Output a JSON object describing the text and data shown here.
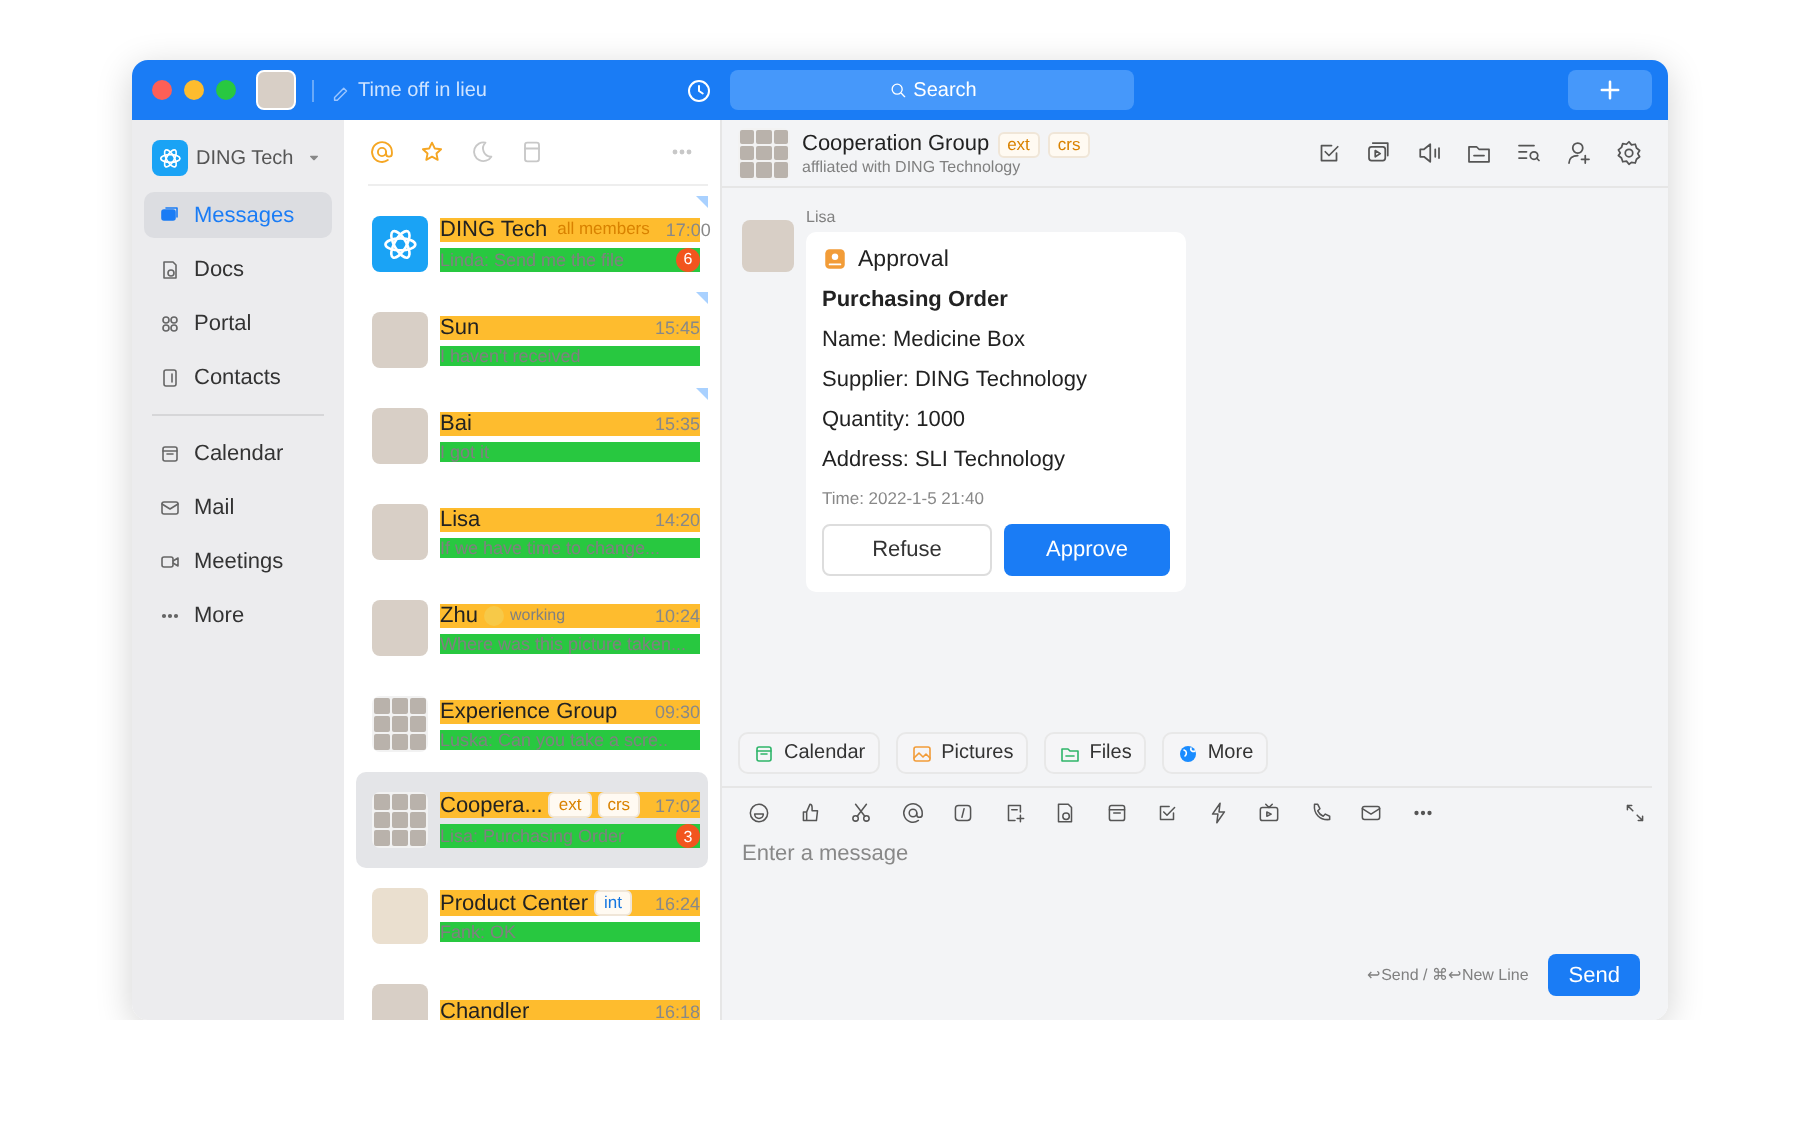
{
  "title_bar": {
    "status": "Time off in lieu",
    "search": {
      "placeholder": "Search"
    }
  },
  "sidebar": {
    "org": "DING Tech",
    "sections": [
      {
        "items": [
          {
            "label": "Messages",
            "selected": true
          },
          {
            "label": "Docs",
            "selected": false
          },
          {
            "label": "Portal",
            "selected": false
          },
          {
            "label": "Contacts",
            "selected": false
          }
        ]
      },
      {
        "items": [
          {
            "label": "Calendar",
            "selected": false
          },
          {
            "label": "Mail",
            "selected": false
          },
          {
            "label": "Meetings",
            "selected": false
          },
          {
            "label": "More",
            "selected": false
          }
        ]
      }
    ]
  },
  "list_tabs": [
    {
      "on": true
    },
    {
      "on": true
    },
    {
      "on": false
    },
    {
      "on": false
    }
  ],
  "conversations": [
    {
      "name": "DING Tech",
      "kind": "logo",
      "tags": [
        {
          "text": "all members",
          "kind": "plain",
          "color": "#d98200"
        }
      ],
      "time": "17:00",
      "preview": "Linda: Send me the file",
      "unread": "6",
      "pinned": true,
      "selected": false
    },
    {
      "name": "Sun",
      "kind": "person",
      "time": "15:45",
      "preview": "I haven't received",
      "pinned": true,
      "selected": false
    },
    {
      "name": "Bai",
      "kind": "person",
      "time": "15:35",
      "preview": "I got it",
      "pinned": true,
      "selected": false
    },
    {
      "name": "Lisa",
      "kind": "person",
      "time": "14:20",
      "preview": "If we have time to change...",
      "pinned": false,
      "selected": false
    },
    {
      "name": "Zhu",
      "kind": "person",
      "status": "working",
      "time": "10:24",
      "preview": "Where was this picture taken...",
      "pinned": false,
      "selected": false
    },
    {
      "name": "Experience Group",
      "kind": "group",
      "time": "09:30",
      "preview": "Luska: Can you take a scre..",
      "pinned": false,
      "selected": false
    },
    {
      "name": "Coopera...",
      "kind": "group",
      "tags": [
        {
          "text": "ext",
          "kind": "boxed",
          "color": "#d98200"
        },
        {
          "text": "crs",
          "kind": "boxed",
          "color": "#d98200"
        }
      ],
      "time": "17:02",
      "preview": "Lisa: Purchasing Order",
      "unread": "3",
      "pinned": false,
      "selected": true
    },
    {
      "name": "Product Center",
      "kind": "photo",
      "tags": [
        {
          "text": "int",
          "kind": "boxed",
          "color": "#1677e0"
        }
      ],
      "time": "16:24",
      "preview": "Fank: OK",
      "pinned": false,
      "selected": false
    },
    {
      "name": "Chandler",
      "kind": "person",
      "time": "16:18",
      "pinned": false,
      "selected": false
    }
  ],
  "chat": {
    "title": "Cooperation Group",
    "tags": [
      {
        "text": "ext",
        "kind": "boxed",
        "color": "#d98200"
      },
      {
        "text": "crs",
        "kind": "boxed",
        "color": "#d98200"
      }
    ],
    "subtitle": "affliated with DING Technology",
    "message": {
      "sender": "Lisa",
      "card": {
        "header": "Approval",
        "title": "Purchasing Order",
        "fields": [
          "Name: Medicine Box",
          "Supplier: DING Technology",
          "Quantity: 1000",
          "Address: SLI Technology"
        ],
        "time": "Time: 2022-1-5 21:40",
        "buttons": [
          {
            "label": "Refuse",
            "kind": "secondary"
          },
          {
            "label": "Approve",
            "kind": "primary"
          }
        ]
      }
    },
    "quick_actions": [
      "Calendar",
      "Pictures",
      "Files",
      "More"
    ],
    "composer": {
      "placeholder": "Enter a message",
      "hint": "↩Send / ⌘↩New Line",
      "send": "Send"
    }
  }
}
